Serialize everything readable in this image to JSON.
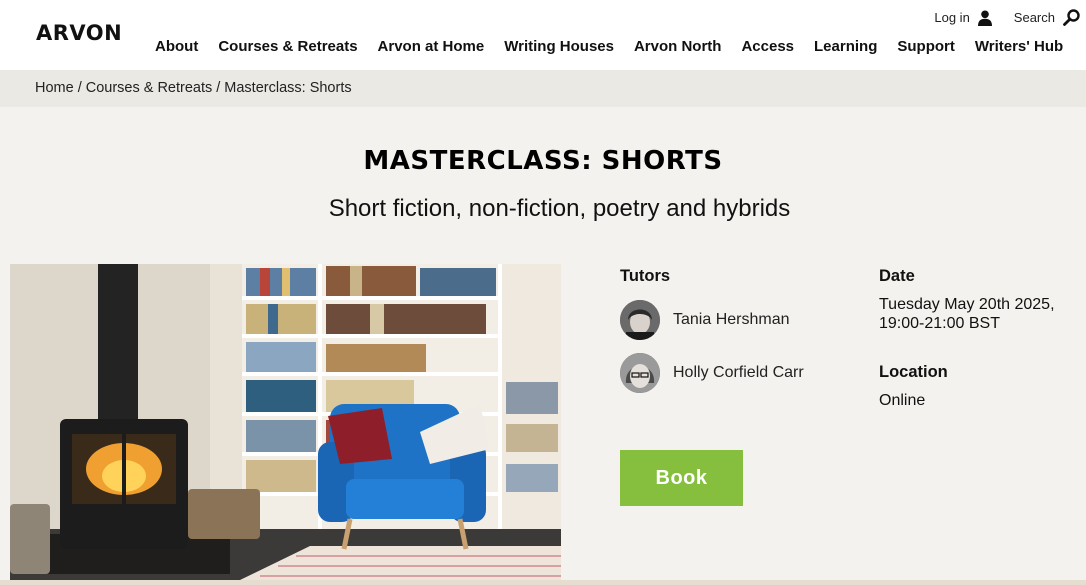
{
  "header": {
    "logo": "ARVON",
    "login_label": "Log in",
    "search_label": "Search",
    "nav": [
      "About",
      "Courses & Retreats",
      "Arvon at Home",
      "Writing Houses",
      "Arvon North",
      "Access",
      "Learning",
      "Support",
      "Writers' Hub"
    ]
  },
  "breadcrumb": [
    "Home",
    "Courses & Retreats",
    "Masterclass: Shorts"
  ],
  "course": {
    "title": "MASTERCLASS: SHORTS",
    "subtitle": "Short fiction, non-fiction, poetry and hybrids"
  },
  "tutors": {
    "heading": "Tutors",
    "list": [
      "Tania Hershman",
      "Holly Corfield Carr"
    ]
  },
  "date": {
    "heading": "Date",
    "line1": "Tuesday May 20th 2025,",
    "line2": "19:00-21:00 BST"
  },
  "location": {
    "heading": "Location",
    "value": "Online"
  },
  "book_label": "Book",
  "colors": {
    "accent_green": "#86bf3e",
    "page_bg": "#f4f2ee",
    "breadcrumb_bg": "#ebe9e4"
  }
}
